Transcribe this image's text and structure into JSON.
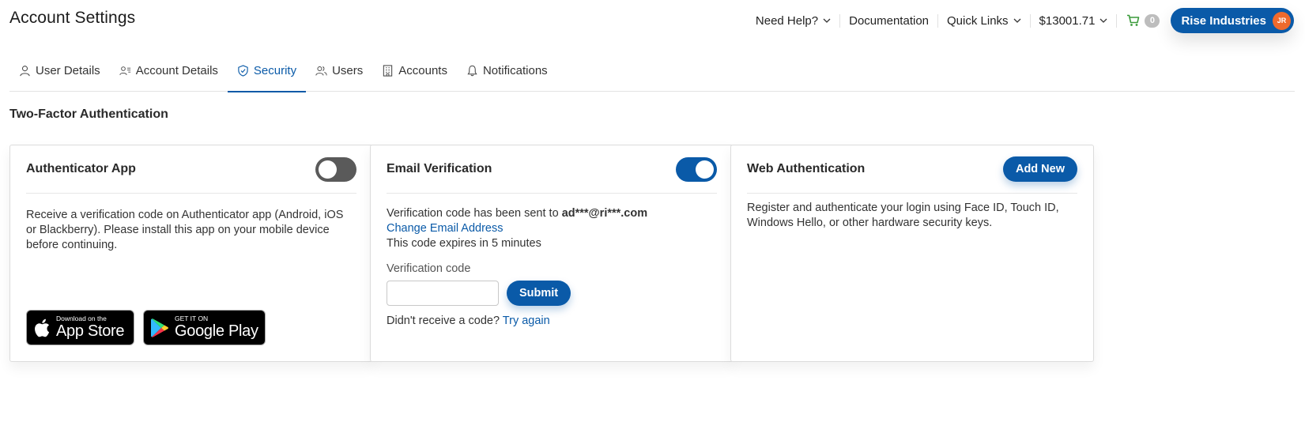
{
  "page": {
    "title": "Account Settings"
  },
  "topnav": {
    "help": "Need Help?",
    "documentation": "Documentation",
    "quick_links": "Quick Links",
    "balance": "$13001.71",
    "cart_count": "0",
    "company": "Rise Industries",
    "avatar_initials": "JR"
  },
  "tabs": [
    {
      "label": "User Details",
      "icon": "user-icon"
    },
    {
      "label": "Account Details",
      "icon": "account-details-icon"
    },
    {
      "label": "Security",
      "icon": "shield-icon",
      "active": true
    },
    {
      "label": "Users",
      "icon": "users-icon"
    },
    {
      "label": "Accounts",
      "icon": "building-icon"
    },
    {
      "label": "Notifications",
      "icon": "bell-icon"
    }
  ],
  "section": {
    "title": "Two-Factor Authentication"
  },
  "authenticator": {
    "title": "Authenticator App",
    "enabled": false,
    "description": "Receive a verification code on Authenticator app (Android, iOS or Blackberry). Please install this app on your mobile device before continuing.",
    "app_store_small": "Download on the",
    "app_store_big": "App Store",
    "google_play_small": "GET IT ON",
    "google_play_big": "Google Play"
  },
  "email": {
    "title": "Email Verification",
    "enabled": true,
    "sent_text": "Verification code has been sent to ",
    "masked_email": "ad***@ri***.com",
    "change_link": "Change Email Address",
    "expires_text": "This code expires in 5 minutes",
    "code_label": "Verification code",
    "code_value": "",
    "submit_label": "Submit",
    "no_code_text": "Didn't receive a code? ",
    "try_again": "Try again"
  },
  "webauthn": {
    "title": "Web Authentication",
    "add_label": "Add New",
    "description": "Register and authenticate your login using Face ID, Touch ID, Windows Hello, or other hardware security keys."
  },
  "colors": {
    "primary": "#0a5aa8",
    "toggle_off": "#5a5a5a",
    "avatar": "#ef6a2d",
    "cart_icon": "#3a9a3a"
  }
}
